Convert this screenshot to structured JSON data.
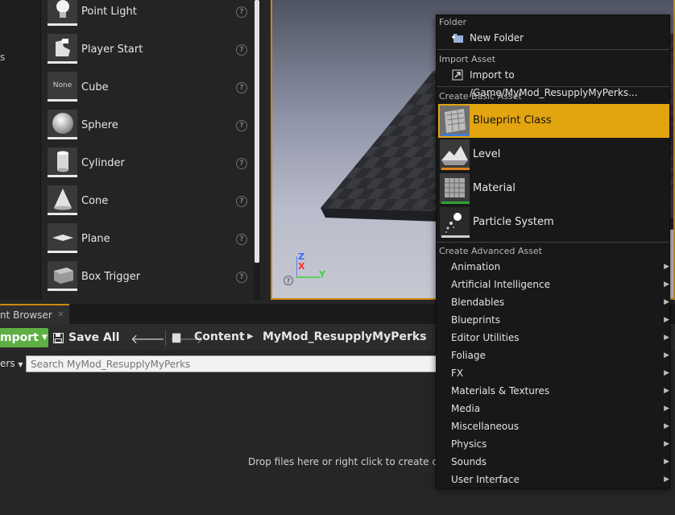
{
  "left_strip": {
    "fragment": "s"
  },
  "place_actors": {
    "items": [
      {
        "label": "Point Light",
        "icon": "point-light-icon"
      },
      {
        "label": "Player Start",
        "icon": "player-start-icon"
      },
      {
        "label": "Cube",
        "icon": "cube-icon",
        "thumb_text": "None"
      },
      {
        "label": "Sphere",
        "icon": "sphere-icon"
      },
      {
        "label": "Cylinder",
        "icon": "cylinder-icon"
      },
      {
        "label": "Cone",
        "icon": "cone-icon"
      },
      {
        "label": "Plane",
        "icon": "plane-icon"
      },
      {
        "label": "Box Trigger",
        "icon": "box-trigger-icon"
      }
    ],
    "help_glyph": "?"
  },
  "viewport": {
    "axis_z": "Z",
    "axis_x": "X",
    "axis_y": "Y",
    "help_glyph": "?"
  },
  "content_browser": {
    "tab_label": "nt Browser",
    "tab_close": "×",
    "import_label": "mport",
    "save_all_label": "Save All",
    "breadcrumb": [
      "Content",
      "MyMod_ResupplyMyPerks"
    ],
    "filters_label": "ers",
    "search_placeholder": "Search MyMod_ResupplyMyPerks",
    "drop_hint": "Drop files here or right click to create conten"
  },
  "context_menu": {
    "sections": {
      "folder": "Folder",
      "import_asset": "Import Asset",
      "create_basic": "Create Basic Asset",
      "create_advanced": "Create Advanced Asset"
    },
    "new_folder": "New Folder",
    "import_to": "Import to /Game/MyMod_ResupplyMyPerks...",
    "basic_assets": [
      {
        "label": "Blueprint Class",
        "icon": "blueprint-class-icon",
        "bar_color": "#3f7fd6",
        "selected": true
      },
      {
        "label": "Level",
        "icon": "level-icon",
        "bar_color": "#e0831a",
        "selected": false
      },
      {
        "label": "Material",
        "icon": "material-icon",
        "bar_color": "#2fa33a",
        "selected": false
      },
      {
        "label": "Particle System",
        "icon": "particle-system-icon",
        "bar_color": "#cfcfcf",
        "selected": false
      }
    ],
    "advanced_assets": [
      "Animation",
      "Artificial Intelligence",
      "Blendables",
      "Blueprints",
      "Editor Utilities",
      "Foliage",
      "FX",
      "Materials & Textures",
      "Media",
      "Miscellaneous",
      "Physics",
      "Sounds",
      "User Interface"
    ],
    "submenu_arrow": "▶"
  },
  "colors": {
    "accent": "#e2a40f",
    "import_green": "#5eb045",
    "viewport_border": "#c88a10"
  }
}
